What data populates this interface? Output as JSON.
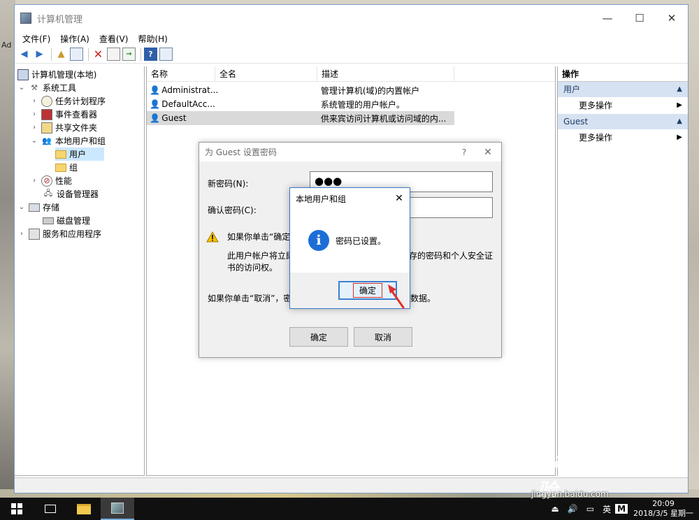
{
  "desktop": {
    "left_text": "Ad"
  },
  "window": {
    "title": "计算机管理",
    "controls": {
      "minimize": "—",
      "maximize": "☐",
      "close": "✕"
    },
    "menu": [
      "文件(F)",
      "操作(A)",
      "查看(V)",
      "帮助(H)"
    ]
  },
  "tree": [
    {
      "label": "计算机管理(本地)",
      "expander": "",
      "icon": "computer-icon"
    },
    {
      "label": "系统工具",
      "expander": "⌄",
      "icon": "tools-icon"
    },
    {
      "label": "任务计划程序",
      "expander": "›",
      "icon": "clock-icon"
    },
    {
      "label": "事件查看器",
      "expander": "›",
      "icon": "event-viewer-icon"
    },
    {
      "label": "共享文件夹",
      "expander": "›",
      "icon": "shared-folder-icon"
    },
    {
      "label": "本地用户和组",
      "expander": "⌄",
      "icon": "users-icon"
    },
    {
      "label": "用户",
      "expander": "",
      "icon": "folder-icon"
    },
    {
      "label": "组",
      "expander": "",
      "icon": "folder-icon"
    },
    {
      "label": "性能",
      "expander": "›",
      "icon": "performance-icon"
    },
    {
      "label": "设备管理器",
      "expander": "",
      "icon": "device-manager-icon"
    },
    {
      "label": "存储",
      "expander": "⌄",
      "icon": "storage-icon"
    },
    {
      "label": "磁盘管理",
      "expander": "",
      "icon": "disk-icon"
    },
    {
      "label": "服务和应用程序",
      "expander": "›",
      "icon": "services-icon"
    }
  ],
  "list": {
    "columns": [
      "名称",
      "全名",
      "描述"
    ],
    "rows": [
      {
        "name": "Administrat...",
        "fullname": "",
        "description": "管理计算机(域)的内置帐户"
      },
      {
        "name": "DefaultAcc...",
        "fullname": "",
        "description": "系统管理的用户帐户。"
      },
      {
        "name": "Guest",
        "fullname": "",
        "description": "供来宾访问计算机或访问域的内..."
      }
    ]
  },
  "actions": {
    "title": "操作",
    "groups": [
      {
        "label": "用户",
        "item": "更多操作"
      },
      {
        "label": "Guest",
        "item": "更多操作"
      }
    ]
  },
  "password_dialog": {
    "title": "为 Guest 设置密码",
    "help": "?",
    "close": "✕",
    "new_password_label": "新密码(N):",
    "new_password_value": "●●●",
    "confirm_password_label": "确认密码(C):",
    "confirm_password_value": "",
    "warn_line": "如果你单击“确定",
    "body_text_line1_a": "此用户帐户将立即",
    "body_text_line1_b": "存的密码和个人安全证",
    "body_text_line2": "书的访问权。",
    "cancel_text_a": "如果你单击“取消”，密",
    "cancel_text_b": "数据。",
    "ok_label": "确定",
    "cancel_label": "取消"
  },
  "message_box": {
    "title": "本地用户和组",
    "close": "✕",
    "message": "密码已设置。",
    "ok_label": "确定"
  },
  "taskbar": {
    "tray_ime": "英",
    "tray_m": "M",
    "time": "20:09",
    "date": "2018/3/5 星期一"
  },
  "watermark": {
    "brand": "Bai du 经验",
    "url": "jingyan.baidu.com"
  },
  "colors": {
    "accent": "#3b79c4",
    "selection": "#cce8ff",
    "taskbar": "#101010"
  }
}
